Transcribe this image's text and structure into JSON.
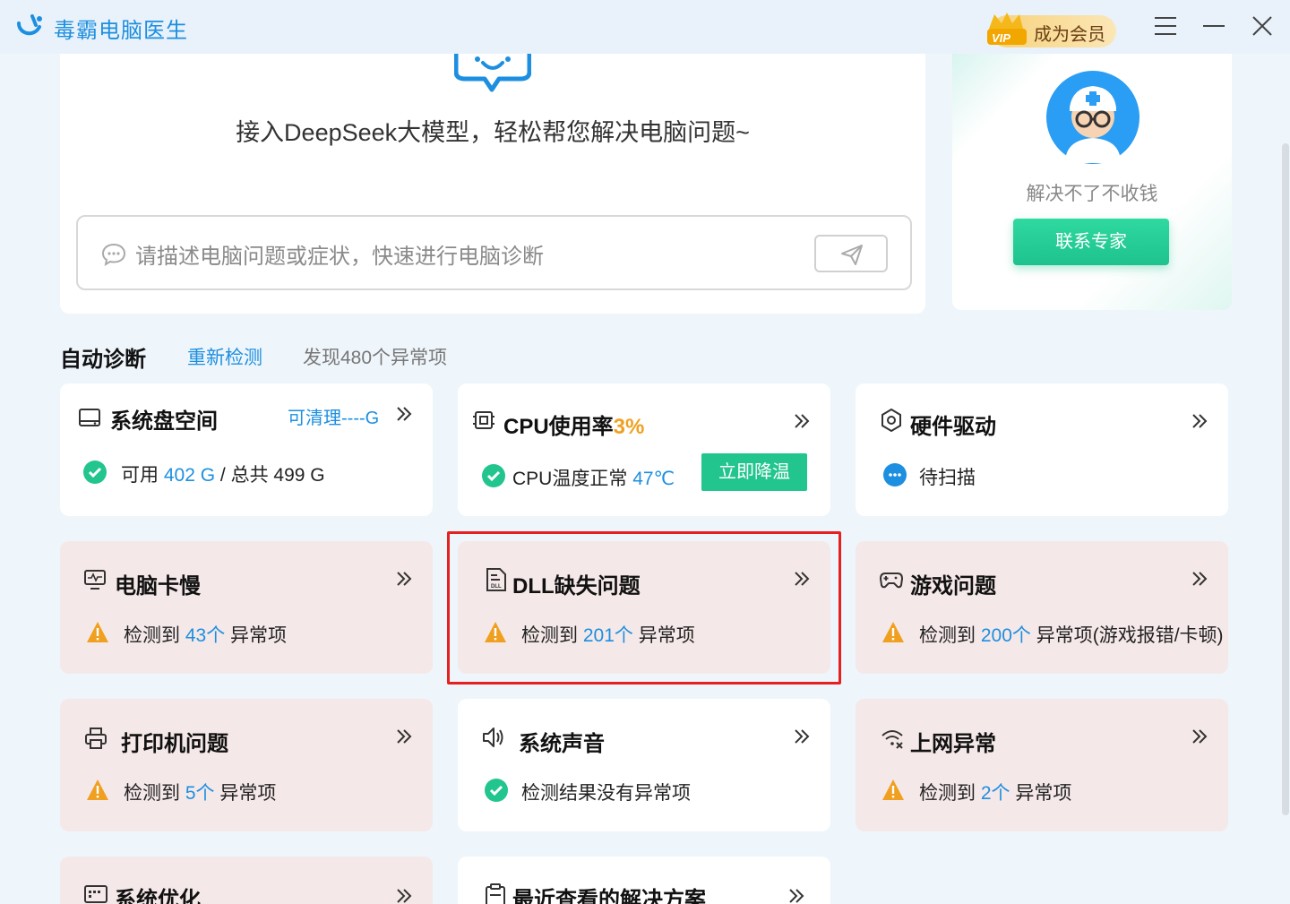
{
  "window": {
    "title": "毒霸电脑医生",
    "vip_label": "成为会员",
    "vip_badge": "VIP"
  },
  "chat": {
    "tagline": "接入DeepSeek大模型，轻松帮您解决电脑问题~",
    "placeholder": "请描述电脑问题或症状，快速进行电脑诊断"
  },
  "expert": {
    "text": "解决不了不收钱",
    "button": "联系专家"
  },
  "section": {
    "title": "自动诊断",
    "recheck": "重新检测",
    "found": "发现480个异常项"
  },
  "cards": {
    "disk": {
      "title": "系统盘空间",
      "clean": "可清理----G",
      "avail_label": "可用",
      "avail_value": "402 G",
      "total": "/ 总共 499 G"
    },
    "cpu": {
      "title": "CPU使用率",
      "usage": "3%",
      "temp_label": "CPU温度正常",
      "temp_value": "47℃",
      "button": "立即降温"
    },
    "hardware": {
      "title": "硬件驱动",
      "status": "待扫描"
    },
    "slow": {
      "title": "电脑卡慢",
      "prefix": "检测到",
      "count": "43个",
      "suffix": "异常项"
    },
    "dll": {
      "title": "DLL缺失问题",
      "prefix": "检测到",
      "count": "201个",
      "suffix": "异常项"
    },
    "game": {
      "title": "游戏问题",
      "prefix": "检测到",
      "count": "200个",
      "suffix": "异常项(游戏报错/卡顿)"
    },
    "printer": {
      "title": "打印机问题",
      "prefix": "检测到",
      "count": "5个",
      "suffix": "异常项"
    },
    "sound": {
      "title": "系统声音",
      "status": "检测结果没有异常项"
    },
    "network": {
      "title": "上网异常",
      "prefix": "检测到",
      "count": "2个",
      "suffix": "异常项"
    },
    "optimize": {
      "title": "系统优化"
    },
    "recent": {
      "title": "最近查看的解决方案"
    }
  },
  "colors": {
    "accent": "#1d8fe0",
    "ok": "#22c58d",
    "warn": "#f0a020",
    "warn_card": "#f5e8e8",
    "highlight": "#e52020"
  }
}
